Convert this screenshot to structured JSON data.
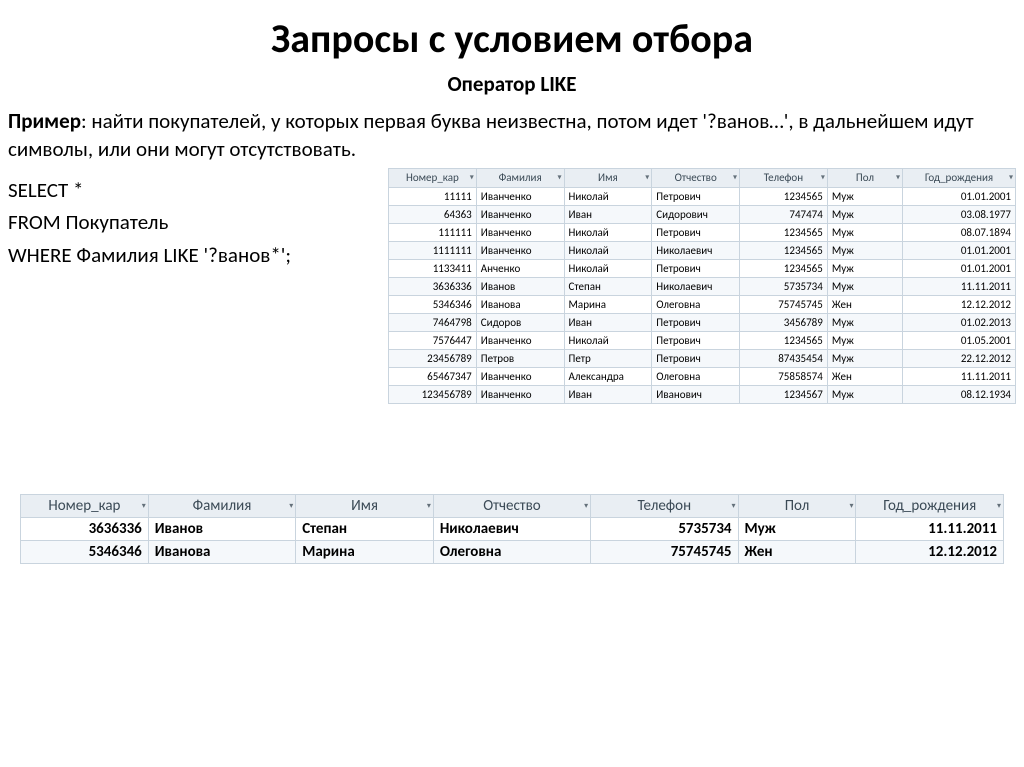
{
  "title": "Запросы с условием отбора",
  "subtitle": "Оператор LIKE",
  "example_label": "Пример",
  "example_text": ": найти покупателей, у которых первая буква неизвестна, потом идет '?ванов…', в дальнейшем идут символы, или они могут отсутствовать.",
  "sql_lines": {
    "l1": "SELECT *",
    "l2": "FROM Покупатель",
    "l3": "WHERE Фамилия LIKE '?ванов*';"
  },
  "columns": {
    "c1": "Номер_кар",
    "c2": "Фамилия",
    "c3": "Имя",
    "c4": "Отчество",
    "c5": "Телефон",
    "c6": "Пол",
    "c7": "Год_рождения"
  },
  "source_rows": [
    {
      "num": "11111",
      "fam": "Иванченко",
      "name": "Николай",
      "otch": "Петрович",
      "tel": "1234565",
      "pol": "Муж",
      "god": "01.01.2001"
    },
    {
      "num": "64363",
      "fam": "Иванченко",
      "name": "Иван",
      "otch": "Сидорович",
      "tel": "747474",
      "pol": "Муж",
      "god": "03.08.1977"
    },
    {
      "num": "111111",
      "fam": "Иванченко",
      "name": "Николай",
      "otch": "Петрович",
      "tel": "1234565",
      "pol": "Муж",
      "god": "08.07.1894"
    },
    {
      "num": "1111111",
      "fam": "Иванченко",
      "name": "Николай",
      "otch": "Николаевич",
      "tel": "1234565",
      "pol": "Муж",
      "god": "01.01.2001"
    },
    {
      "num": "1133411",
      "fam": "Анченко",
      "name": "Николай",
      "otch": "Петрович",
      "tel": "1234565",
      "pol": "Муж",
      "god": "01.01.2001"
    },
    {
      "num": "3636336",
      "fam": "Иванов",
      "name": "Степан",
      "otch": "Николаевич",
      "tel": "5735734",
      "pol": "Муж",
      "god": "11.11.2011"
    },
    {
      "num": "5346346",
      "fam": "Иванова",
      "name": "Марина",
      "otch": "Олеговна",
      "tel": "75745745",
      "pol": "Жен",
      "god": "12.12.2012"
    },
    {
      "num": "7464798",
      "fam": "Сидоров",
      "name": "Иван",
      "otch": "Петрович",
      "tel": "3456789",
      "pol": "Муж",
      "god": "01.02.2013"
    },
    {
      "num": "7576447",
      "fam": "Иванченко",
      "name": "Николай",
      "otch": "Петрович",
      "tel": "1234565",
      "pol": "Муж",
      "god": "01.05.2001"
    },
    {
      "num": "23456789",
      "fam": "Петров",
      "name": "Петр",
      "otch": "Петрович",
      "tel": "87435454",
      "pol": "Муж",
      "god": "22.12.2012"
    },
    {
      "num": "65467347",
      "fam": "Иванченко",
      "name": "Александра",
      "otch": "Олеговна",
      "tel": "75858574",
      "pol": "Жен",
      "god": "11.11.2011"
    },
    {
      "num": "123456789",
      "fam": "Иванченко",
      "name": "Иван",
      "otch": "Иванович",
      "tel": "1234567",
      "pol": "Муж",
      "god": "08.12.1934"
    }
  ],
  "result_rows": [
    {
      "num": "3636336",
      "fam": "Иванов",
      "name": "Степан",
      "otch": "Николаевич",
      "tel": "5735734",
      "pol": "Муж",
      "god": "11.11.2011"
    },
    {
      "num": "5346346",
      "fam": "Иванова",
      "name": "Марина",
      "otch": "Олеговна",
      "tel": "75745745",
      "pol": "Жен",
      "god": "12.12.2012"
    }
  ]
}
